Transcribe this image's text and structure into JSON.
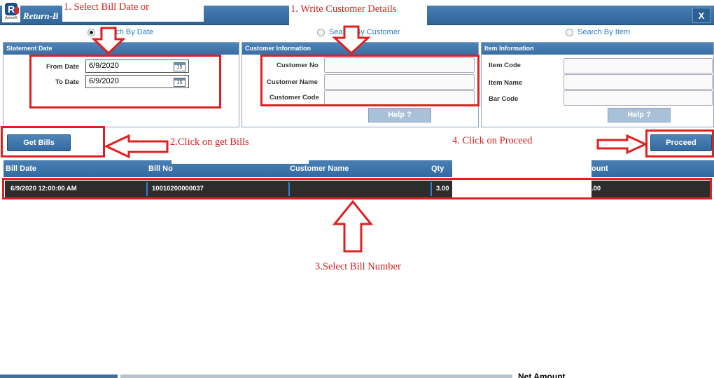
{
  "window": {
    "title": "Return-B",
    "close_label": "X",
    "logo_letter": "R",
    "logo_text": "AnimoR"
  },
  "search_modes": [
    {
      "label": "Search By Date",
      "selected": true
    },
    {
      "label": "Search By Customer",
      "selected": false
    },
    {
      "label": "Search By Item",
      "selected": false
    }
  ],
  "statement_date": {
    "header": "Statement Date",
    "from_label": "From Date",
    "from_value": "6/9/2020",
    "to_label": "To Date",
    "to_value": "6/9/2020",
    "calendar_glyph": "15"
  },
  "customer_info": {
    "header": "Customer Information",
    "no_label": "Customer No",
    "name_label": "Customer Name",
    "code_label": "Customer Code",
    "help_label": "Help ?"
  },
  "item_info": {
    "header": "Item Information",
    "code_label": "Item Code",
    "name_label": "Item Name",
    "barcode_label": "Bar Code",
    "help_label": "Help ?"
  },
  "buttons": {
    "get_bills": "Get Bills",
    "proceed": "Proceed"
  },
  "grid": {
    "columns": [
      "Bill Date",
      "Bill No",
      "Customer Name",
      "Qty",
      "ount"
    ],
    "rows": [
      {
        "bill_date": "6/9/2020 12:00:00 AM",
        "bill_no": "10010200000037",
        "customer_name": "",
        "qty": "3.00",
        "amount": ".00"
      }
    ]
  },
  "annotations": {
    "step1a": "1. Select Bill Date or",
    "step1b": "1. Write Customer Details",
    "step2": "2.Click on get Bills",
    "step3": "3.Select Bill Number",
    "step4": "4. Click on Proceed"
  },
  "footer": {
    "net_amount_label": "Net Amount"
  },
  "colors": {
    "header_blue": "#3a6ea3",
    "annotation_red": "#e02020",
    "link_blue": "#2e7fc0"
  }
}
